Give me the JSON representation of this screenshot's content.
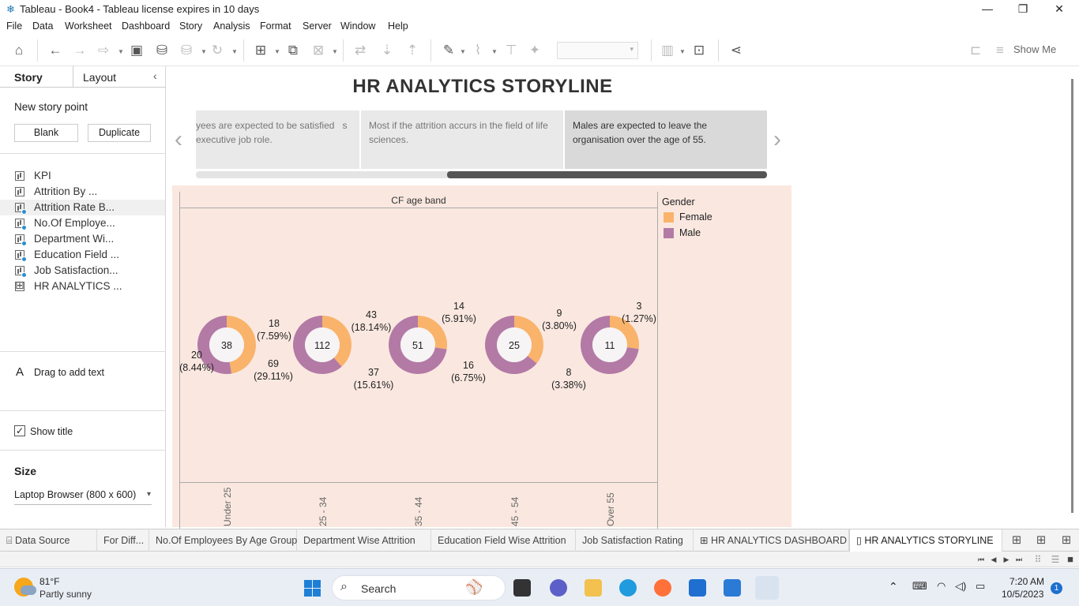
{
  "window": {
    "title": "Tableau - Book4 - Tableau license expires in 10 days",
    "minimize": "—",
    "restore": "❐",
    "close": "✕"
  },
  "menu": [
    "File",
    "Data",
    "Worksheet",
    "Dashboard",
    "Story",
    "Analysis",
    "Format",
    "Server",
    "Window",
    "Help"
  ],
  "toolbar": {
    "show_me": "Show Me"
  },
  "sidebar": {
    "tab_story": "Story",
    "tab_layout": "Layout",
    "new_story_point": "New story point",
    "blank_button": "Blank",
    "duplicate_button": "Duplicate",
    "sheets": [
      {
        "label": "KPI",
        "type": "sheet",
        "used": false
      },
      {
        "label": "Attrition By ...",
        "type": "sheet",
        "used": false
      },
      {
        "label": "Attrition Rate B...",
        "type": "sheet",
        "used": true
      },
      {
        "label": "No.Of Employe...",
        "type": "sheet",
        "used": true
      },
      {
        "label": "Department Wi...",
        "type": "sheet",
        "used": true
      },
      {
        "label": "Education Field ...",
        "type": "sheet",
        "used": true
      },
      {
        "label": "Job Satisfaction...",
        "type": "sheet",
        "used": true
      },
      {
        "label": "HR ANALYTICS ...",
        "type": "dashboard",
        "used": false
      }
    ],
    "drag_text_icon": "A",
    "drag_text": "Drag to add text",
    "show_title_check": "✓",
    "show_title": "Show title",
    "size_heading": "Size",
    "size_value": "Laptop Browser (800 x 600)"
  },
  "story": {
    "title": "HR ANALYTICS STORYLINE",
    "prev_arrow": "‹",
    "next_arrow": "›",
    "points": [
      "yees are expected to be satisfied   s executive job role.",
      "Most if the attrition accurs in the field of life sciences.",
      "Males are expected  to leave the organisation over the age of 55."
    ]
  },
  "chart_data": {
    "type": "pie",
    "subtype": "donut",
    "column_header": "CF age band",
    "legend_title": "Gender",
    "legend_placement": "right",
    "series": [
      {
        "name": "Female",
        "color": "#f9b36b"
      },
      {
        "name": "Male",
        "color": "#b37aa6"
      }
    ],
    "categories": [
      "Under 25",
      "25 - 34",
      "35 - 44",
      "45 - 54",
      "Over 55"
    ],
    "totals": [
      38,
      112,
      51,
      25,
      11
    ],
    "female": [
      {
        "value": 18,
        "pct": "(7.59%)"
      },
      {
        "value": 43,
        "pct": "(18.14%)"
      },
      {
        "value": 14,
        "pct": "(5.91%)"
      },
      {
        "value": 9,
        "pct": "(3.80%)"
      },
      {
        "value": 3,
        "pct": "(1.27%)"
      }
    ],
    "male": [
      {
        "value": 20,
        "pct": "(8.44%)"
      },
      {
        "value": 69,
        "pct": "(29.11%)"
      },
      {
        "value": 37,
        "pct": "(15.61%)"
      },
      {
        "value": 16,
        "pct": "(6.75%)"
      },
      {
        "value": 8,
        "pct": "(3.38%)"
      }
    ]
  },
  "tabs": [
    {
      "label": "Data Source",
      "icon": "⌸",
      "active": false
    },
    {
      "label": "For Diff...",
      "icon": "",
      "active": false
    },
    {
      "label": "No.Of Employees By Age Group",
      "icon": "",
      "active": false
    },
    {
      "label": "Department Wise Attrition",
      "icon": "",
      "active": false
    },
    {
      "label": "Education Field Wise Attrition",
      "icon": "",
      "active": false
    },
    {
      "label": "Job Satisfaction Rating",
      "icon": "",
      "active": false
    },
    {
      "label": "HR ANALYTICS DASHBOARD",
      "icon": "⊞",
      "active": false
    },
    {
      "label": "HR ANALYTICS STORYLINE",
      "icon": "▯",
      "active": true
    }
  ],
  "taskbar": {
    "weather_temp": "81°F",
    "weather_desc": "Partly sunny",
    "search_placeholder": "Search",
    "time": "7:20 AM",
    "date": "10/5/2023",
    "notifications": "1"
  }
}
